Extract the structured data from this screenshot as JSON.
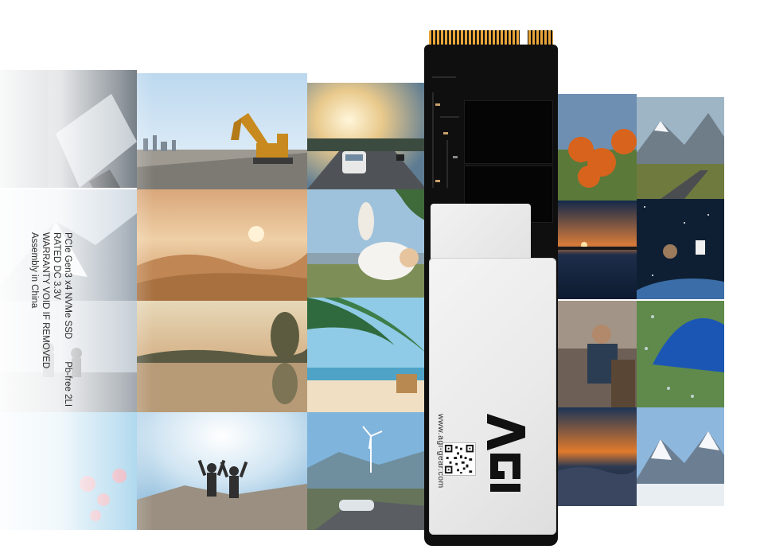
{
  "ssd_label": {
    "line1": "PCIe Gen3 x4 NVMe SSD",
    "line1_right": "Pb-free 2LI",
    "line2": "RATED DC 3.3V",
    "line3": "WARRANTY VOID IF REMOVED",
    "line4": "Assembly in China",
    "website": "www.agi-gear.com",
    "brand": "AGI"
  },
  "colors": {
    "pcb": "#0f0f0f",
    "gold_connector": "#e8a53a",
    "label": "#eeeeee",
    "label_text": "#2b2b2b"
  },
  "icons": [
    "qr-code-icon",
    "agi-logo-icon"
  ]
}
